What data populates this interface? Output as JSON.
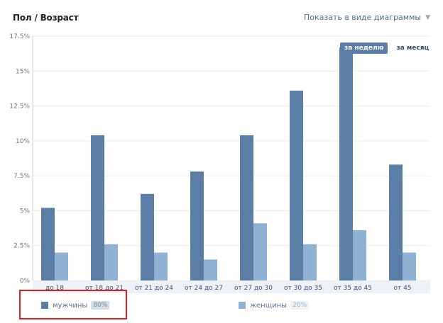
{
  "header": {
    "title": "Пол / Возраст",
    "view_link": "Показать в виде диаграммы"
  },
  "tabs": [
    {
      "label": "за неделю",
      "active": true
    },
    {
      "label": "за месяц",
      "active": false
    }
  ],
  "legend": [
    {
      "label": "мужчины",
      "percent": "80%",
      "color": "#5b7ea6"
    },
    {
      "label": "женщины",
      "percent": "20%",
      "color": "#8fb1d3"
    }
  ],
  "colors": {
    "men": "#5b7ea6",
    "women": "#8fb1d3",
    "highlight": "#e02020"
  },
  "chart_data": {
    "type": "bar",
    "categories": [
      "до 18",
      "от 18 до 21",
      "от 21 до 24",
      "от 24 до 27",
      "от 27 до 30",
      "от 30 до 35",
      "от 35 до 45",
      "от 45"
    ],
    "series": [
      {
        "name": "мужчины",
        "values": [
          5.2,
          10.4,
          6.2,
          7.8,
          10.4,
          13.6,
          16.7,
          8.3
        ]
      },
      {
        "name": "женщины",
        "values": [
          2.0,
          2.6,
          2.0,
          1.5,
          4.1,
          2.6,
          3.6,
          2.0
        ]
      }
    ],
    "yticks": [
      "0%",
      "2.5%",
      "5%",
      "7.5%",
      "10%",
      "12.5%",
      "15%",
      "17.5%"
    ],
    "ylim": [
      0,
      17.5
    ],
    "grid": true
  }
}
